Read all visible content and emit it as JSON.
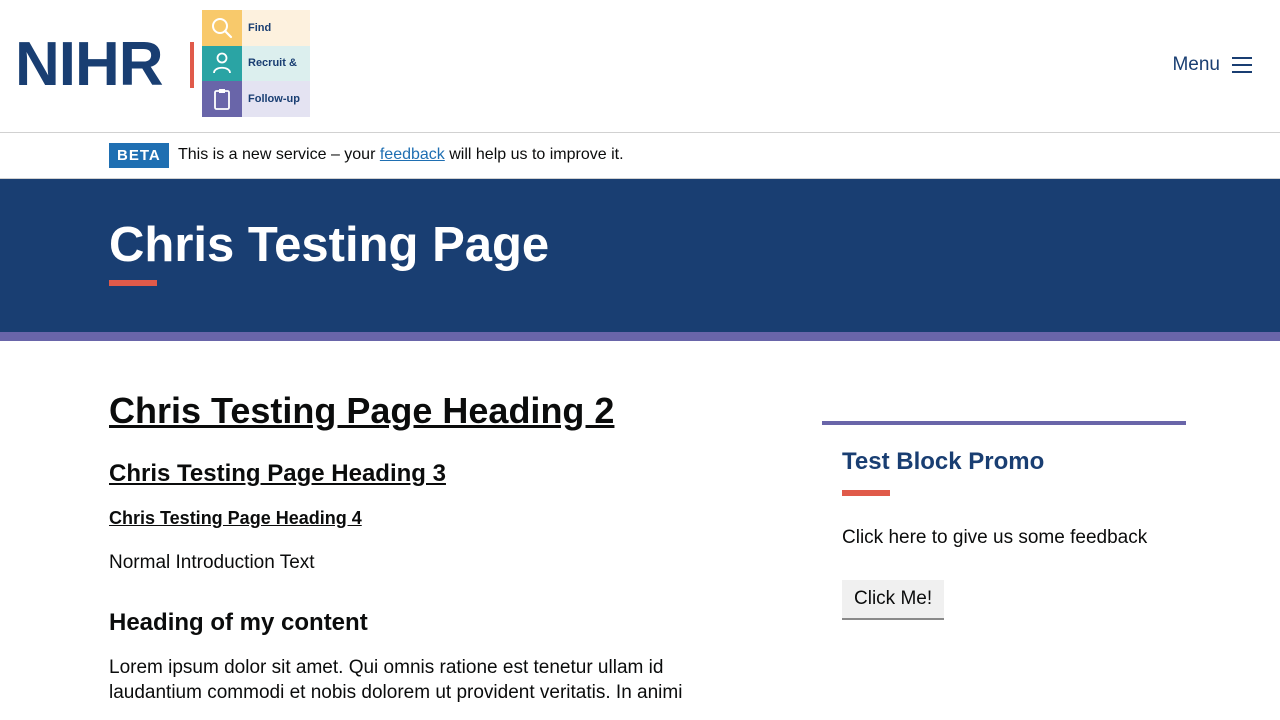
{
  "header": {
    "logo_text": "NIHR",
    "find_recruit_logo": {
      "rows": [
        {
          "label": "Find",
          "icon": "magnifier-icon"
        },
        {
          "label": "Recruit &",
          "icon": "person-icon"
        },
        {
          "label": "Follow-up",
          "icon": "clipboard-icon"
        }
      ]
    },
    "menu_label": "Menu"
  },
  "beta_banner": {
    "tag": "BETA",
    "text_before": "This is a new service – your ",
    "link_text": "feedback",
    "text_after": " will help us to improve it."
  },
  "hero": {
    "title": "Chris Testing Page"
  },
  "main": {
    "heading2": "Chris Testing Page Heading 2",
    "heading3": "Chris Testing Page Heading 3",
    "heading4": "Chris Testing Page Heading 4",
    "intro": "Normal Introduction Text",
    "content_heading": "Heading of my content",
    "paragraph": "Lorem ipsum dolor sit amet. Qui omnis ratione est tenetur ullam id laudantium commodi et nobis dolorem ut provident veritatis. In animi"
  },
  "promo": {
    "title": "Test Block Promo",
    "text": "Click here to give us some feedback",
    "button_label": "Click Me!"
  },
  "colors": {
    "navy": "#193e72",
    "coral": "#e05a4a",
    "purple": "#6965a9",
    "beta_blue": "#1f6fb2"
  }
}
